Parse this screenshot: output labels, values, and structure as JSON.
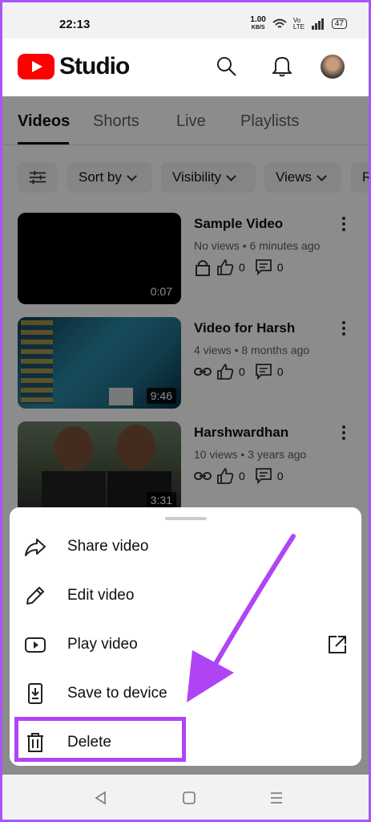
{
  "status": {
    "time": "22:13",
    "speed": "1.00",
    "speed_unit": "KB/S",
    "network": "Vo LTE",
    "battery": "47"
  },
  "header": {
    "brand": "Studio"
  },
  "tabs": [
    {
      "label": "Videos",
      "active": true
    },
    {
      "label": "Shorts",
      "active": false
    },
    {
      "label": "Live",
      "active": false
    },
    {
      "label": "Playlists",
      "active": false
    }
  ],
  "filters": [
    "Sort by",
    "Visibility",
    "Views",
    "R"
  ],
  "videos": [
    {
      "title": "Sample Video",
      "meta": "No views • 6 minutes ago",
      "duration": "0:07",
      "likes": "0",
      "comments": "0"
    },
    {
      "title": "Video for Harsh",
      "meta": "4 views • 8 months ago",
      "duration": "9:46",
      "likes": "0",
      "comments": "0"
    },
    {
      "title": "Harshwardhan",
      "meta": "10 views • 3 years ago",
      "duration": "3:31",
      "likes": "0",
      "comments": "0"
    }
  ],
  "menu": [
    {
      "label": "Share video",
      "icon": "share-icon"
    },
    {
      "label": "Edit video",
      "icon": "pencil-icon"
    },
    {
      "label": "Play video",
      "icon": "play-icon"
    },
    {
      "label": "Save to device",
      "icon": "download-icon"
    },
    {
      "label": "Delete",
      "icon": "trash-icon"
    }
  ],
  "colors": {
    "accent": "#ff0000",
    "annotation": "#b044f5"
  }
}
